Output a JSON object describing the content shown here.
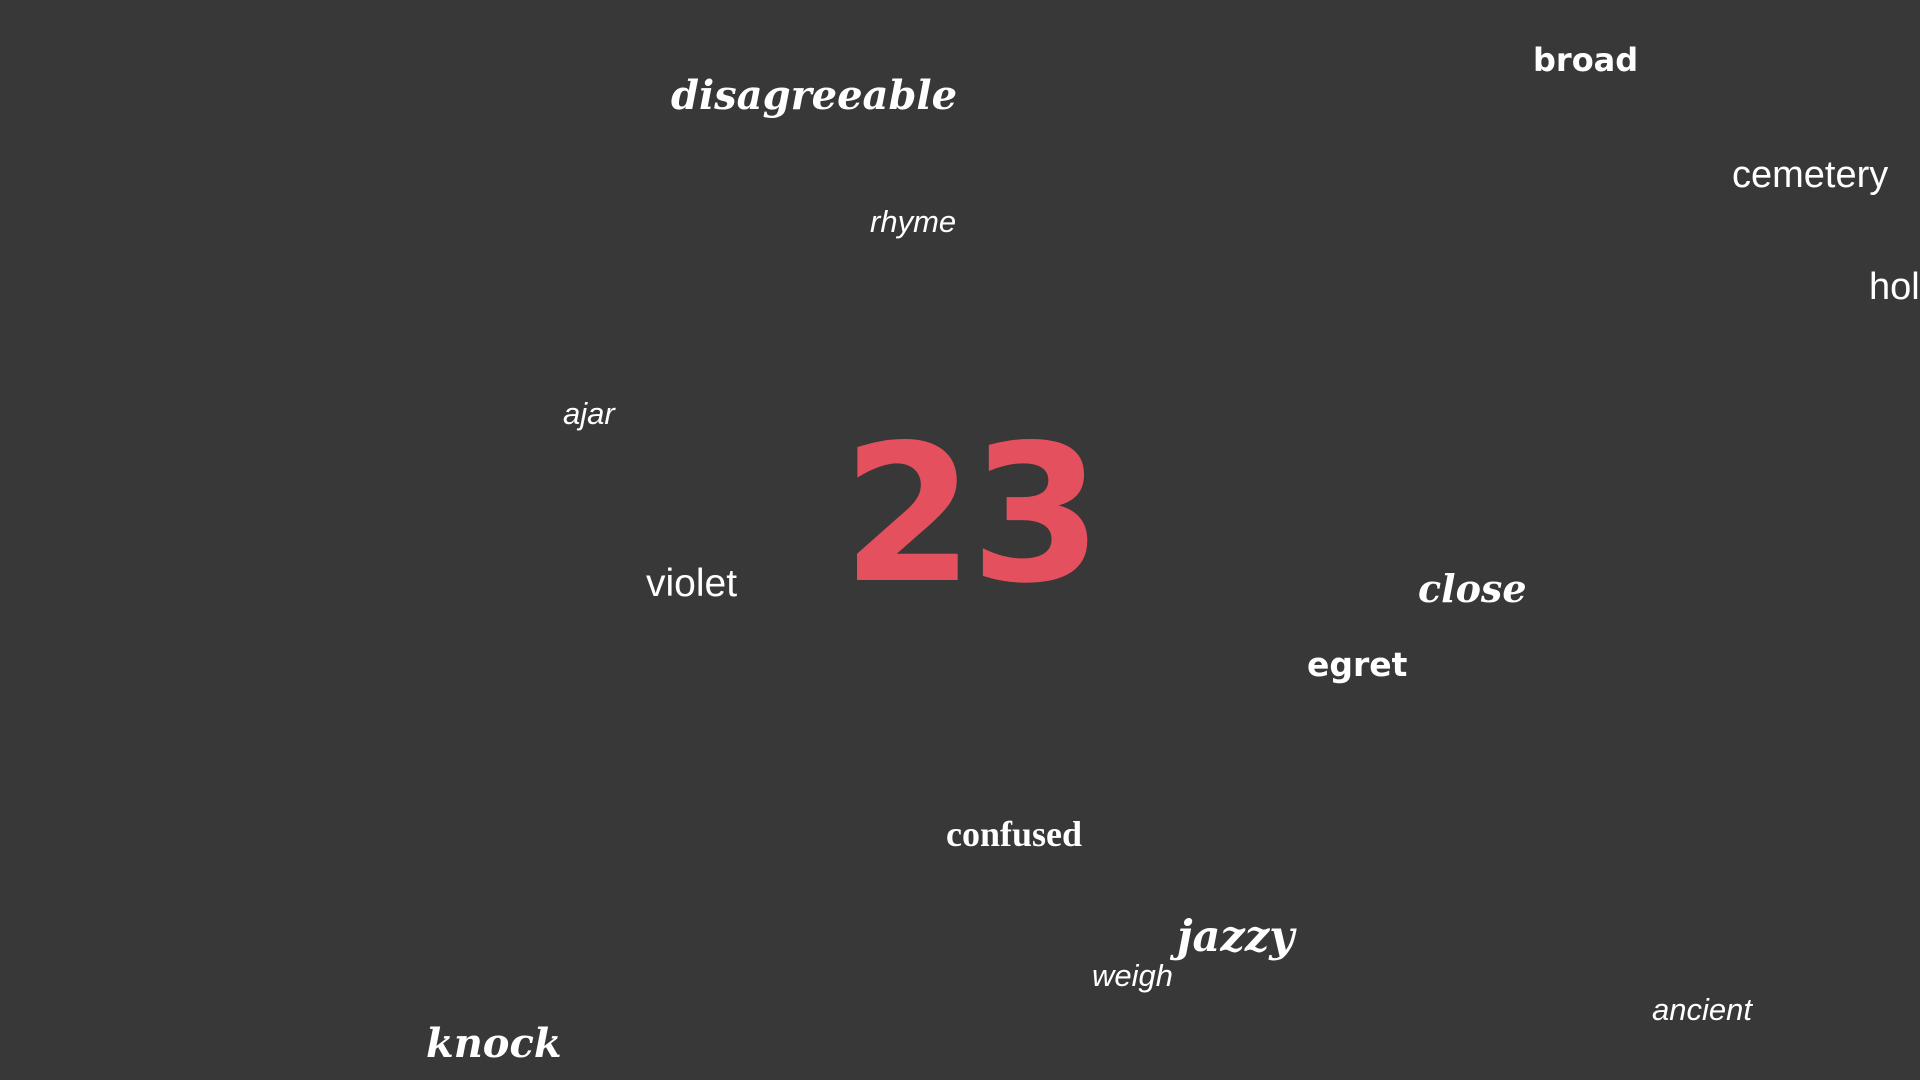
{
  "counter": {
    "value": "23",
    "color": "#e5505e"
  },
  "words": {
    "disagreeable": "disagreeable",
    "broad": "broad",
    "cemetery": "cemetery",
    "hol": "hol",
    "rhyme": "rhyme",
    "ajar": "ajar",
    "violet": "violet",
    "close": "close",
    "egret": "egret",
    "confused": "confused",
    "jazzy": "jazzy",
    "weigh": "weigh",
    "ancient": "ancient",
    "knock": "knock"
  },
  "colors": {
    "background": "#383838",
    "word": "#ffffff"
  }
}
